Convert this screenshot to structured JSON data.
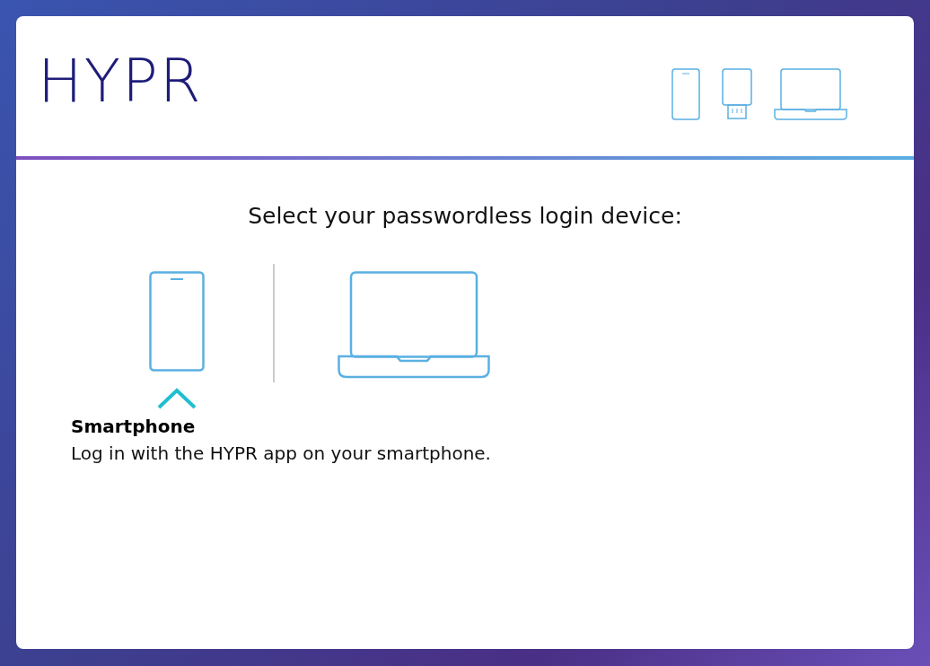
{
  "logo": "HYPR",
  "prompt": "Select your passwordless login device:",
  "devices": [
    {
      "kind": "phone",
      "selected": true
    },
    {
      "kind": "laptop",
      "selected": false
    }
  ],
  "detail": {
    "title": "Smartphone",
    "description": "Log in with the HYPR app on your smartphone."
  }
}
